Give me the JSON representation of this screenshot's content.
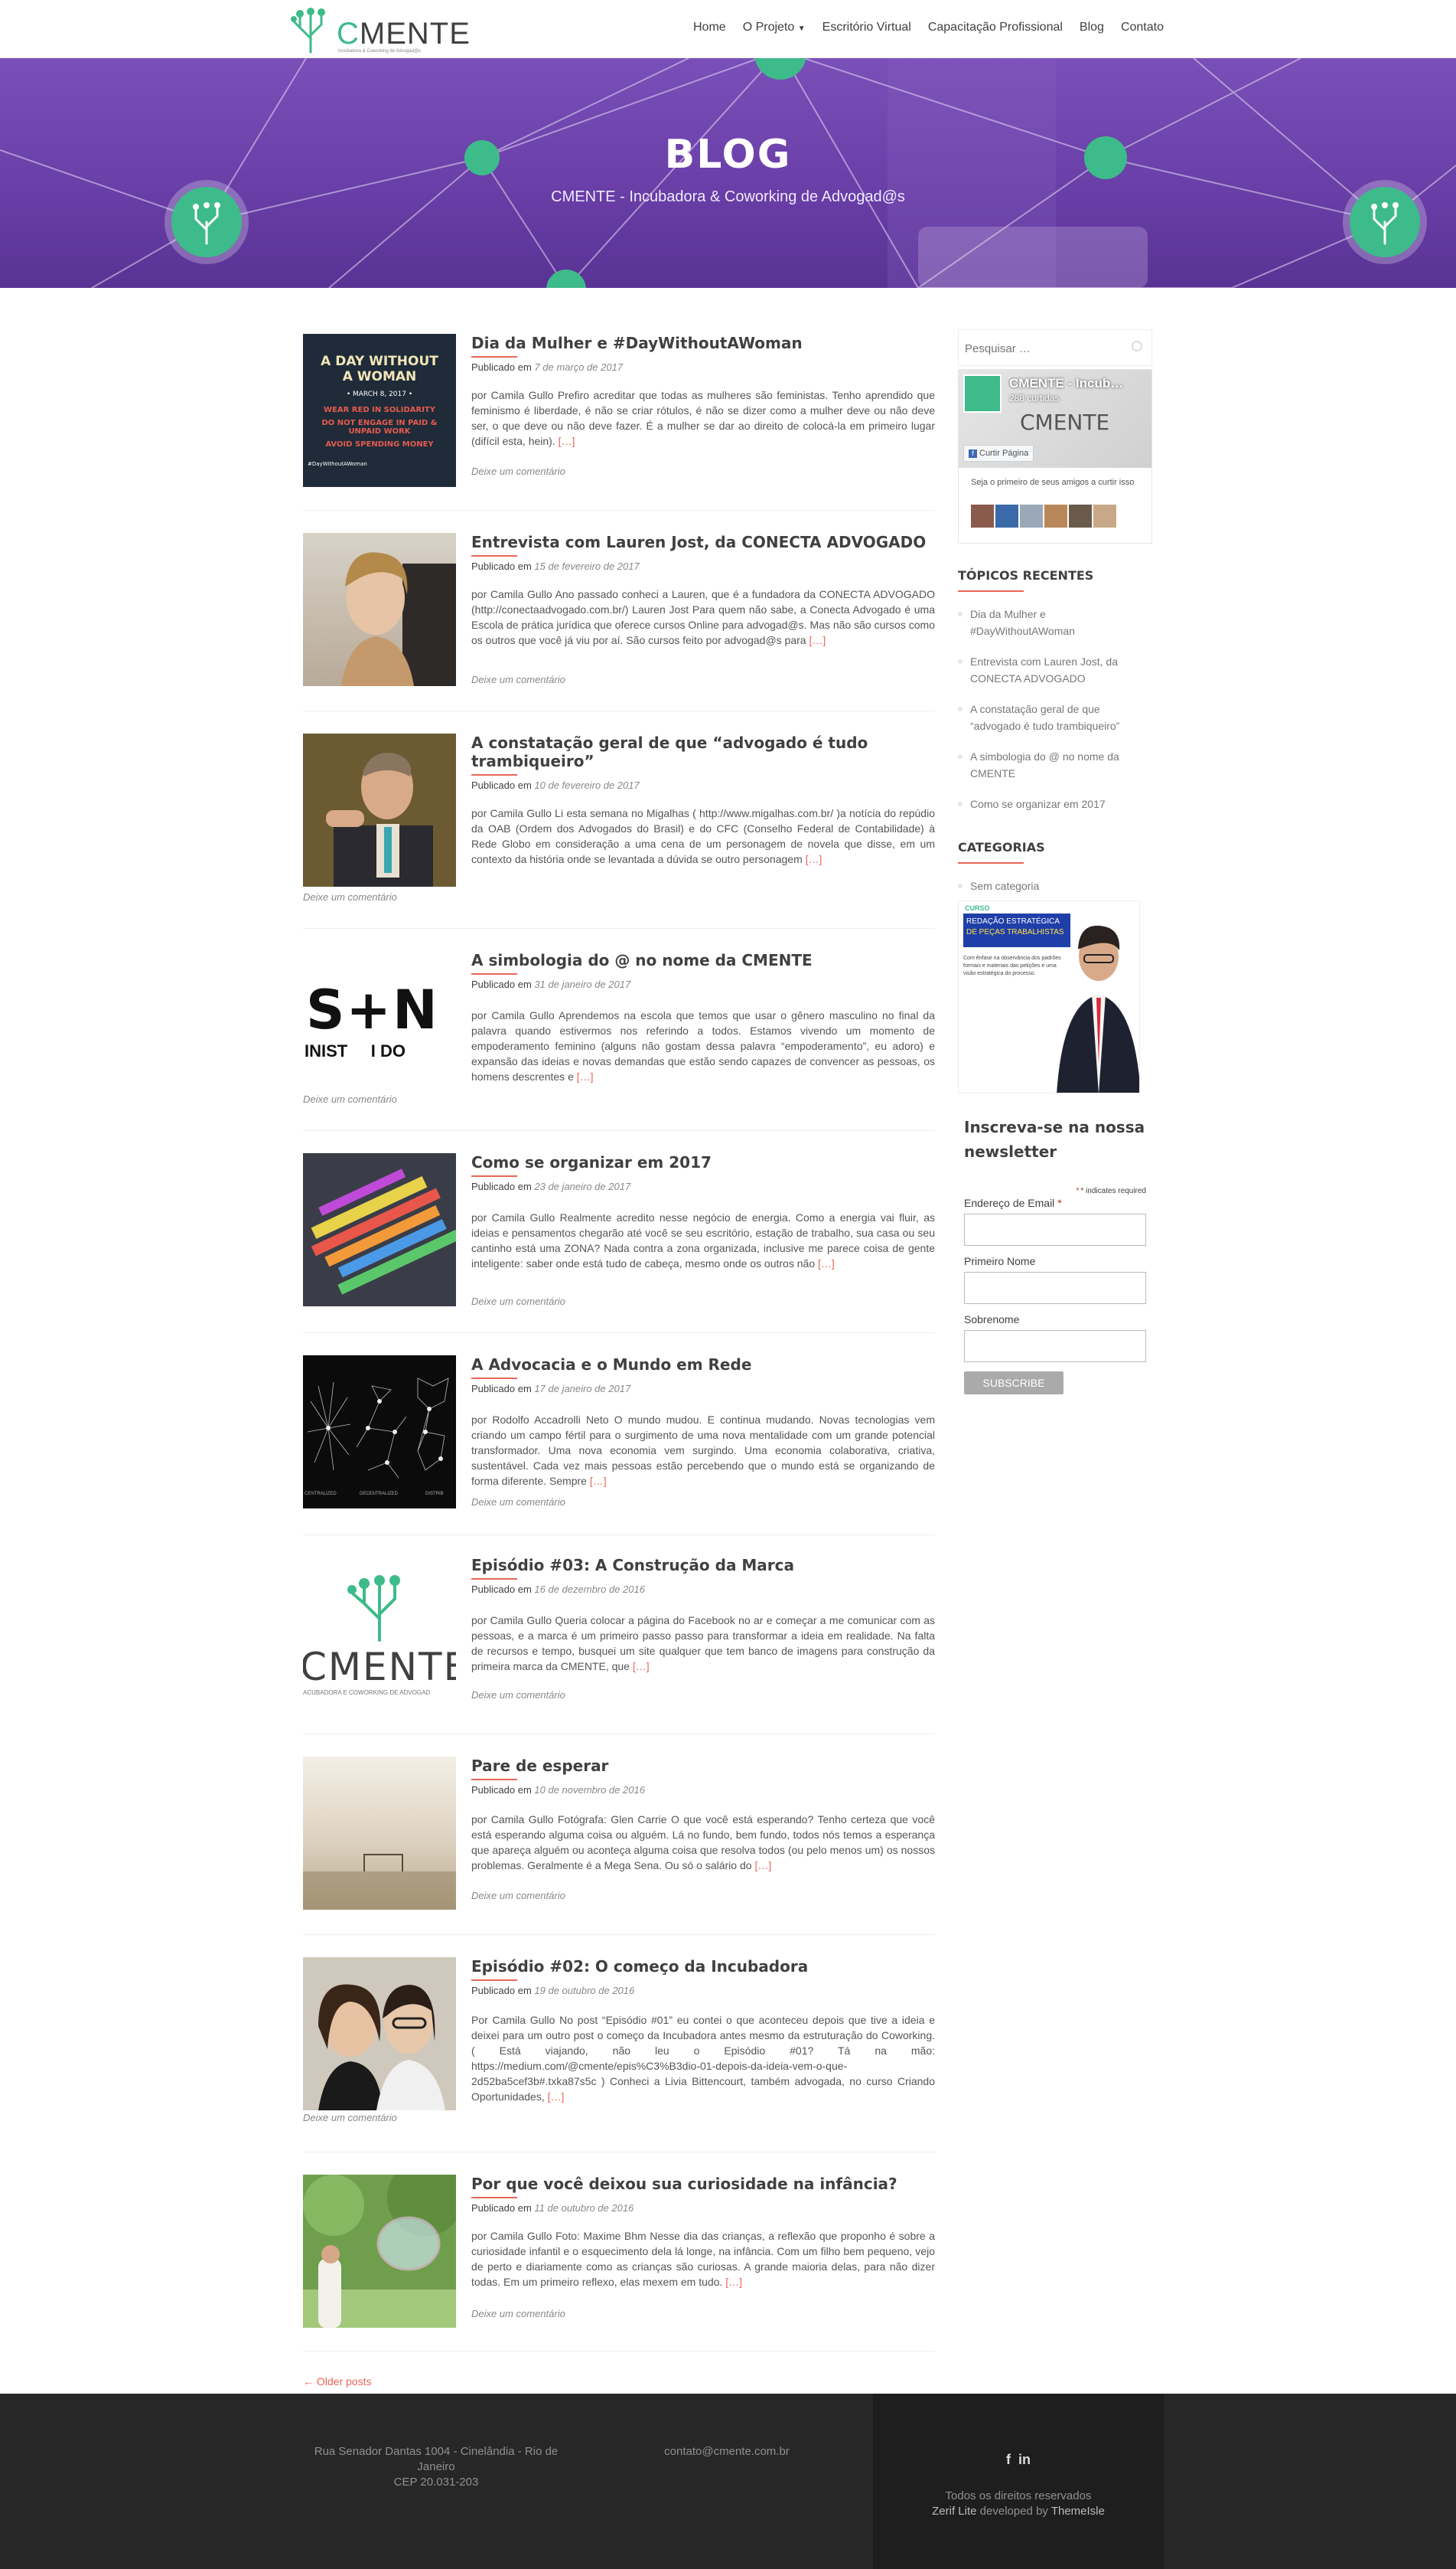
{
  "header": {
    "logo_text_c": "C",
    "logo_text_rest": "MENTE",
    "logo_tagline": "Incubadora & Coworking de Advogad@s",
    "nav": [
      {
        "label": "Home"
      },
      {
        "label": "O Projeto"
      },
      {
        "label": "Escritório Virtual"
      },
      {
        "label": "Capacitação Profissional"
      },
      {
        "label": "Blog"
      },
      {
        "label": "Contato"
      }
    ]
  },
  "hero": {
    "title": "BLOG",
    "subtitle": "CMENTE - Incubadora & Coworking de Advogad@s"
  },
  "posts": [
    {
      "title": "Dia da Mulher e #DayWithoutAWoman",
      "meta_label": "Publicado em",
      "date": "7 de março de 2017",
      "excerpt": "por Camila Gullo Prefiro acreditar que todas as mulheres são feministas. Tenho aprendido que feminismo é liberdade, é não se criar rótulos, é não se dizer como a mulher deve ou não deve ser, o que deve ou não deve fazer. É a mulher se dar ao direito de colocá-la em primeiro lugar (difícil esta, hein).",
      "more": "[…]",
      "comment": "Deixe um comentário"
    },
    {
      "title": "Entrevista com Lauren Jost, da CONECTA ADVOGADO",
      "meta_label": "Publicado em",
      "date": "15 de fevereiro de 2017",
      "excerpt": "por Camila Gullo Ano passado conheci a Lauren, que é a fundadora da CONECTA ADVOGADO (http://conectaadvogado.com.br/) Lauren Jost Para quem não sabe, a Conecta Advogado é uma Escola de prática jurídica que oferece cursos Online para advogad@s. Mas não são cursos como os outros que você já viu por aí. São cursos feito por advogad@s para",
      "more": "[…]",
      "comment": "Deixe um comentário"
    },
    {
      "title": "A constatação geral de que “advogado é tudo trambiqueiro”",
      "meta_label": "Publicado em",
      "date": "10 de fevereiro de 2017",
      "excerpt": "por Camila Gullo Li esta semana no Migalhas ( http://www.migalhas.com.br/ )a notícia do repúdio da OAB (Ordem dos Advogados do Brasil) e do CFC (Conselho Federal de Contabilidade) à Rede Globo em consideração a uma cena de um personagem de novela que disse, em um contexto da história onde se levantada a dúvida se outro personagem",
      "more": "[…]",
      "comment": "Deixe um comentário"
    },
    {
      "title": "A simbologia do @ no nome da CMENTE",
      "meta_label": "Publicado em",
      "date": "31 de janeiro de 2017",
      "excerpt": "por Camila Gullo Aprendemos na escola que temos que usar o gênero masculino no final da palavra quando estivermos nos referindo a todos. Estamos vivendo um momento de empoderamento feminino (alguns não gostam dessa palavra “empoderamento”, eu adoro) e expansão das ideias e novas demandas que estão sendo capazes de convencer as pessoas, os homens descrentes e",
      "more": "[…]",
      "comment": "Deixe um comentário",
      "thumb_text": "S+N",
      "thumb_sub": "INIST     I DO"
    },
    {
      "title": "Como se organizar em 2017",
      "meta_label": "Publicado em",
      "date": "23 de janeiro de 2017",
      "excerpt": "por Camila Gullo Realmente acredito nesse negócio de energia. Como a energia vai fluir, as ideias e pensamentos chegarão até você se seu escritório, estação de trabalho, sua casa ou seu cantinho está uma ZONA? Nada contra a zona organizada, inclusive me parece coisa de gente inteligente: saber onde está tudo de cabeça, mesmo onde os outros não",
      "more": "[…]",
      "comment": "Deixe um comentário"
    },
    {
      "title": "A Advocacia e o Mundo em Rede",
      "meta_label": "Publicado em",
      "date": "17 de janeiro de 2017",
      "excerpt": "por Rodolfo Accadrolli Neto O mundo mudou. E continua mudando. Novas tecnologias vem criando um campo fértil para o surgimento de uma nova mentalidade com um grande potencial transformador. Uma nova economia vem surgindo. Uma economia colaborativa, criativa, sustentável. Cada vez mais pessoas estão percebendo que o mundo está se organizando de forma diferente. Sempre",
      "more": "[…]",
      "comment": "Deixe um comentário",
      "thumb_labels": [
        "CENTRALIZED",
        "DECENTRALIZED",
        "DISTRIB"
      ]
    },
    {
      "title": "Episódio #03: A Construção da Marca",
      "meta_label": "Publicado em",
      "date": "16 de dezembro de 2016",
      "excerpt": "por Camila Gullo Queria colocar a página do Facebook no ar e começar a me comunicar com as pessoas, e a marca é um primeiro passo passo para transformar a ideia em realidade. Na falta de recursos e tempo, busquei um site qualquer que tem banco de imagens para construção da primeira marca da CMENTE, que",
      "more": "[…]",
      "comment": "Deixe um comentário",
      "thumb_text": "CMENTE",
      "thumb_sub": "ACUBADORA E COWORKING DE ADVOGAD"
    },
    {
      "title": "Pare de esperar",
      "meta_label": "Publicado em",
      "date": "10 de novembro de 2016",
      "excerpt": "por Camila Gullo Fotógrafa: Glen Carrie O que você está esperando? Tenho certeza que você está esperando alguma coisa ou alguém. Lá no fundo, bem fundo, todos nós temos a esperança que apareça alguém ou aconteça alguma coisa que resolva todos (ou pelo menos um) os nossos problemas. Geralmente é a Mega Sena. Ou só o salário do",
      "more": "[…]",
      "comment": "Deixe um comentário"
    },
    {
      "title": "Episódio #02: O começo da Incubadora",
      "meta_label": "Publicado em",
      "date": "19 de outubro de 2016",
      "excerpt": "Por Camila Gullo No post “Episódio #01” eu contei o que aconteceu depois que tive a ideia e deixei para um outro post o começo da Incubadora antes mesmo da estruturação do Coworking. ( Está viajando, não leu o Episódio #01? Tá na mão: https://medium.com/@cmente/epis%C3%B3dio-01-depois-da-ideia-vem-o-que-2d52ba5cef3b#.txka87s5c ) Conheci a Livia Bittencourt, também advogada, no curso Criando Oportunidades,",
      "more": "[…]",
      "comment": "Deixe um comentário"
    },
    {
      "title": "Por que você deixou sua curiosidade na infância?",
      "meta_label": "Publicado em",
      "date": "11 de outubro de 2016",
      "excerpt": "por Camila Gullo Foto: Maxime Bhm Nesse dia das crianças, a reflexão que proponho é sobre a curiosidade infantil e o esquecimento dela lá longe, na infância. Com um filho bem pequeno, vejo de perto e diariamente como as crianças são curiosas. A grande maioria delas, para não dizer todas. Em um primeiro reflexo, elas mexem em tudo.",
      "more": "[…]",
      "comment": "Deixe um comentário"
    }
  ],
  "post1_thumb": {
    "line1": "A DAY WITHOUT",
    "line2": "A WOMAN",
    "date": "• MARCH 8, 2017 •",
    "l3": "WEAR RED IN SOLIDARITY",
    "l4": "DO NOT ENGAGE IN PAID &",
    "l5": "UNPAID WORK",
    "l6": "AVOID SPENDING MONEY",
    "foot": "#DayWithoutAWoman"
  },
  "older_posts": "← Older posts",
  "sidebar": {
    "search_placeholder": "Pesquisar …",
    "fb": {
      "name": "CMENTE - Incub…",
      "likes": "288 curtidas",
      "brand": "CMENTE",
      "like_button": "Curtir Página",
      "friends": "Seja o primeiro de seus amigos a curtir isso"
    },
    "recent_title": "TÓPICOS RECENTES",
    "recent": [
      "Dia da Mulher e #DayWithoutAWoman",
      "Entrevista com Lauren Jost, da CONECTA ADVOGADO",
      "A constatação geral de que “advogado é tudo trambiqueiro”",
      "A simbologia do @ no nome da CMENTE",
      "Como se organizar em 2017"
    ],
    "categories_title": "CATEGORIAS",
    "categories": [
      "Sem categoria"
    ],
    "ad": {
      "tag": "CURSO",
      "title1": "REDAÇÃO ESTRATÉGICA",
      "title2": "DE PEÇAS TRABALHISTAS",
      "desc": "Com ênfase na observância dos padrões formais e materiais das petições e uma visão estratégica do processo."
    },
    "newsletter": {
      "title": "Inscreva-se na nossa newsletter",
      "required_note": "* indicates required",
      "email_label": "Endereço de Email",
      "first_label": "Primeiro Nome",
      "last_label": "Sobrenome",
      "submit": "SUBSCRIBE"
    }
  },
  "footer": {
    "address1": "Rua Senador Dantas 1004 - Cinelândia - Rio de Janeiro",
    "address2": "CEP 20.031-203",
    "email": "contato@cmente.com.br",
    "social": [
      "f",
      "in"
    ],
    "rights": "Todos os direitos reservados",
    "credit_theme": "Zerif Lite",
    "credit_dev": "developed by",
    "credit_author": "ThemeIsle"
  },
  "colors": {
    "accent": "#e96656",
    "brand_green": "#3dbb8a",
    "hero_purple": "#6a3fa8",
    "footer": "#272727"
  }
}
